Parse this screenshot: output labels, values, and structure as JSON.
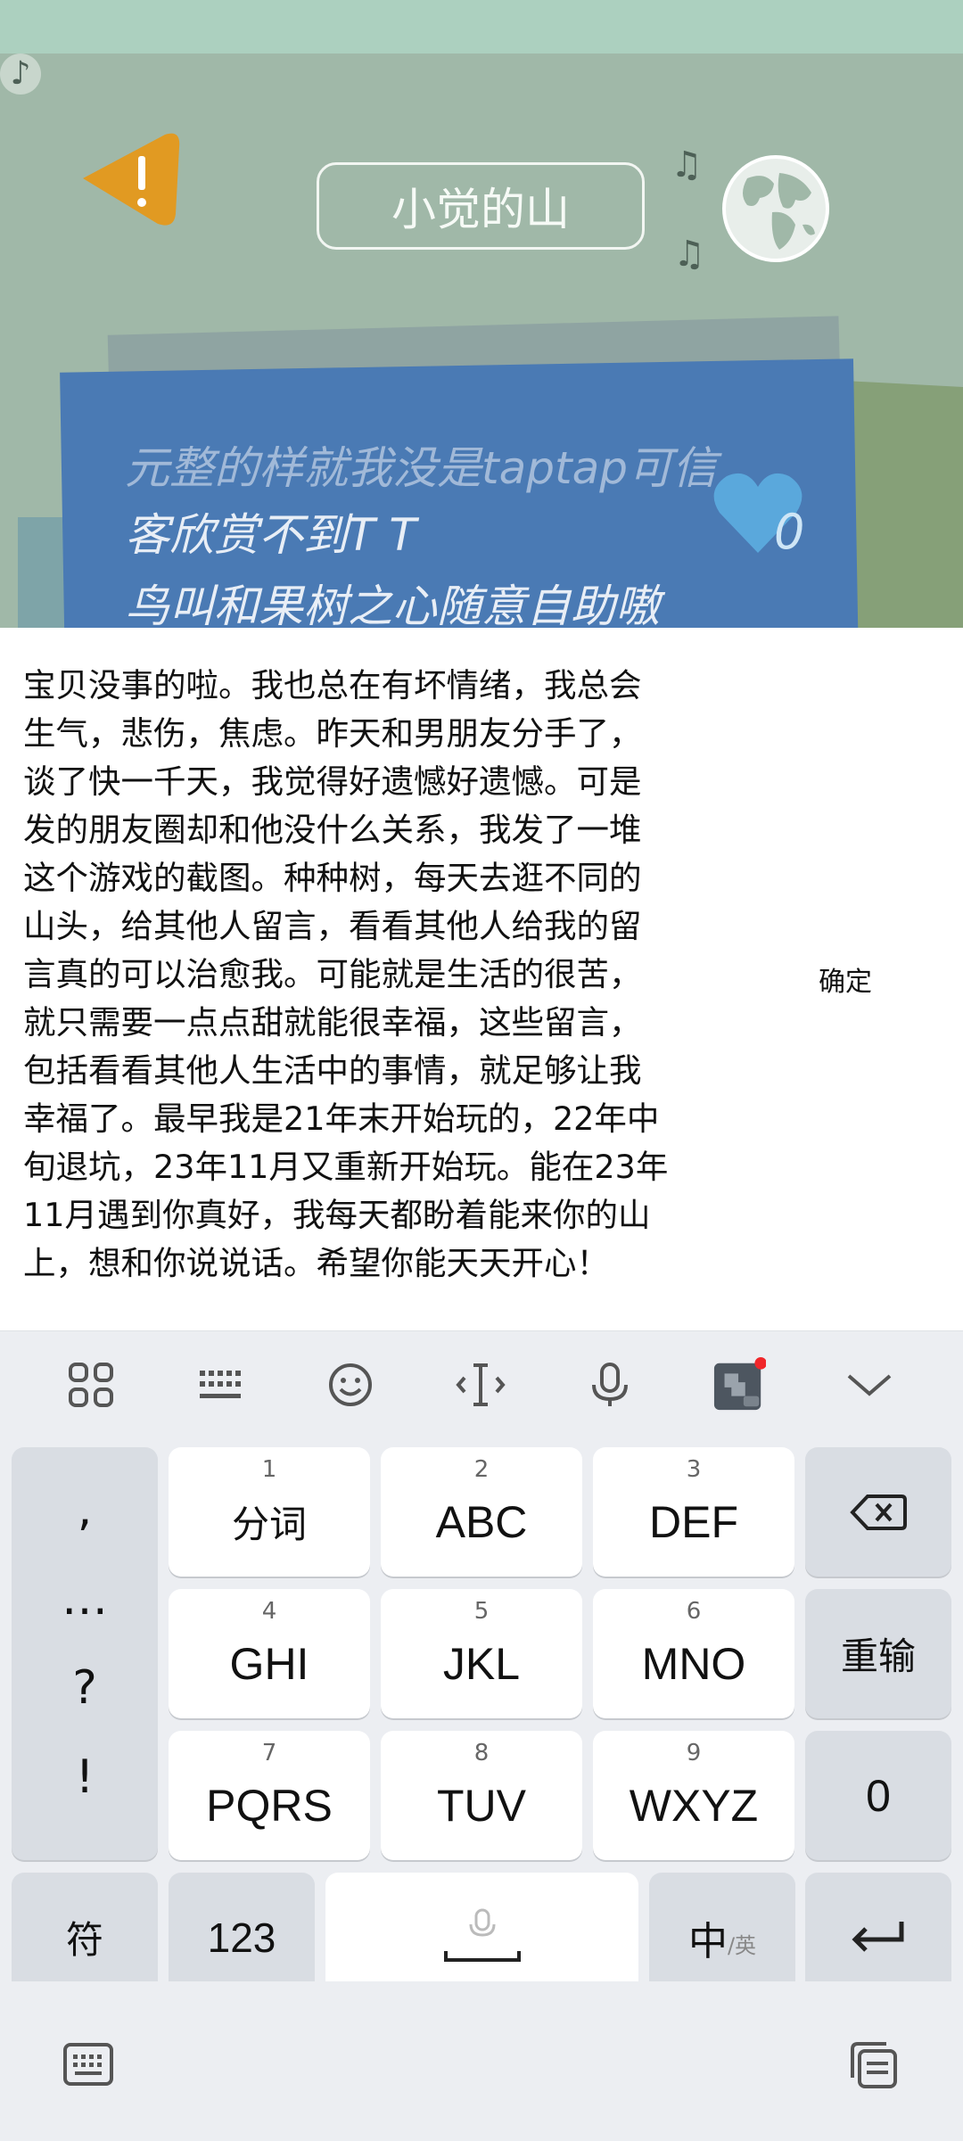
{
  "scene": {
    "title": "小觉的山",
    "paper_lines": [
      "元整的样就我没是taptap可信",
      "客欣赏不到T T",
      "鸟叫和果树之心随意自助嗷"
    ],
    "heart_count": "0"
  },
  "message": {
    "text": "宝贝没事的啦。我也总在有坏情绪，我总会\n生气，悲伤，焦虑。昨天和男朋友分手了，\n谈了快一千天，我觉得好遗憾好遗憾。可是\n发的朋友圈却和他没什么关系，我发了一堆\n这个游戏的截图。种种树，每天去逛不同的\n山头，给其他人留言，看看其他人给我的留\n言真的可以治愈我。可能就是生活的很苦，\n就只需要一点点甜就能很幸福，这些留言，\n包括看看其他人生活中的事情，就足够让我\n幸福了。最早我是21年末开始玩的，22年中\n旬退坑，23年11月又重新开始玩。能在23年\n11月遇到你真好，我每天都盼着能来你的山\n上，想和你说说话。希望你能天天开心！",
    "confirm_label": "确定"
  },
  "keyboard": {
    "toolbar_icons": [
      "grid-icon",
      "keyboard-icon",
      "emoji-icon",
      "cursor-icon",
      "mic-icon",
      "puzzle-icon",
      "collapse-icon"
    ],
    "punct": [
      ",",
      "…",
      "?",
      "!"
    ],
    "keys": [
      {
        "num": "1",
        "label": "分词"
      },
      {
        "num": "2",
        "label": "ABC"
      },
      {
        "num": "3",
        "label": "DEF"
      },
      {
        "num": "4",
        "label": "GHI"
      },
      {
        "num": "5",
        "label": "JKL"
      },
      {
        "num": "6",
        "label": "MNO"
      },
      {
        "num": "7",
        "label": "PQRS"
      },
      {
        "num": "8",
        "label": "TUV"
      },
      {
        "num": "9",
        "label": "WXYZ"
      }
    ],
    "reset_label": "重输",
    "zero_label": "0",
    "symbol_label": "符",
    "num_label": "123",
    "lang_main": "中",
    "lang_sub": "/英"
  },
  "colors": {
    "scene_bg": "#a0b8a8",
    "paper_blue": "#4a7ab4",
    "warning": "#e19a22",
    "heart": "#5aa8dc",
    "notification_dot": "#f0262a"
  }
}
